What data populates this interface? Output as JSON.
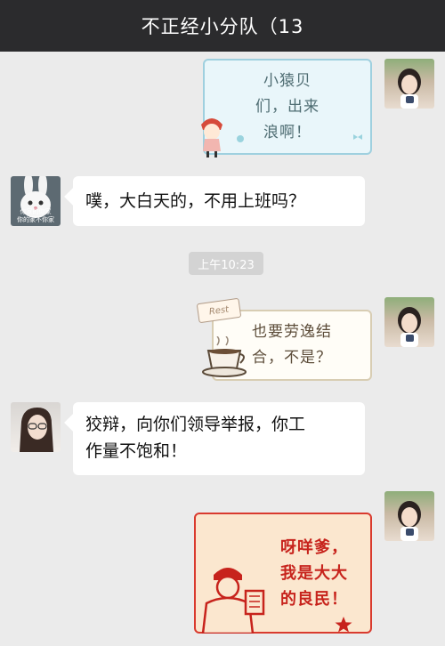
{
  "header": {
    "title": "不正经小分队（13"
  },
  "timestamp": "上午10:23",
  "messages": [
    {
      "sender": "self",
      "type": "sticker",
      "text": "小猿贝\n们，出来\n浪啊！"
    },
    {
      "sender": "rabbit-avatar-user",
      "type": "text",
      "text": "噗，大白天的，不用上班吗？",
      "avatar_caption": "你家的你家\n你的家不你家"
    },
    {
      "sender": "self",
      "type": "sticker",
      "text": "也要劳逸结\n合，不是？",
      "sign": "Rest"
    },
    {
      "sender": "woman-avatar-user",
      "type": "text",
      "text": "狡辩，向你们领导举报，你工\n作量不饱和！"
    },
    {
      "sender": "self",
      "type": "sticker",
      "text": "呀咩爹，\n我是大大\n的良民！"
    }
  ]
}
